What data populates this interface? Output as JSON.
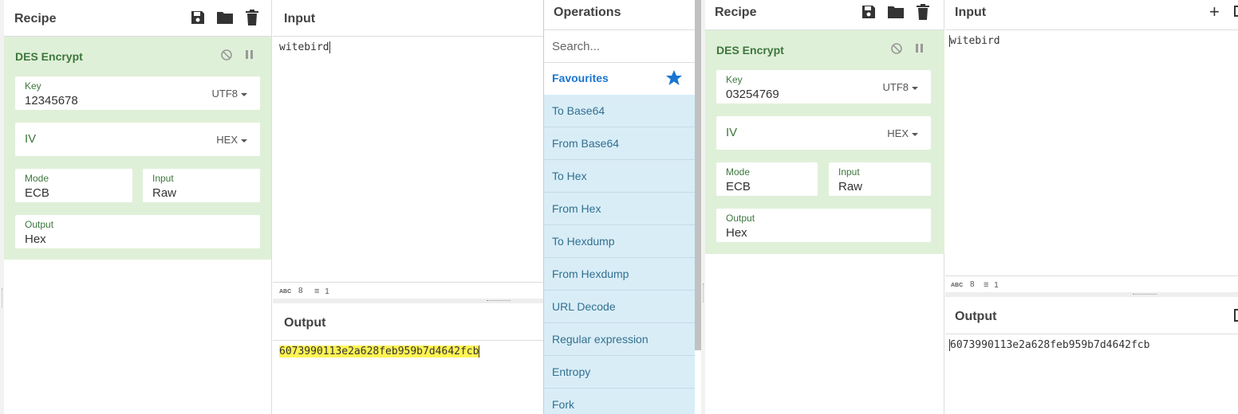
{
  "left": {
    "recipe": {
      "title": "Recipe",
      "operation": {
        "name": "DES Encrypt",
        "key": {
          "label": "Key",
          "value": "12345678",
          "encoding": "UTF8"
        },
        "iv": {
          "label": "IV",
          "encoding": "HEX"
        },
        "mode": {
          "label": "Mode",
          "value": "ECB"
        },
        "input": {
          "label": "Input",
          "value": "Raw"
        },
        "output": {
          "label": "Output",
          "value": "Hex"
        }
      }
    },
    "input": {
      "title": "Input",
      "text": "witebird",
      "stats": {
        "length": "8",
        "lines": "1"
      }
    },
    "output": {
      "title": "Output",
      "text": "6073990113e2a628feb959b7d4642fcb"
    }
  },
  "operations": {
    "title": "Operations",
    "search_placeholder": "Search...",
    "favourites_label": "Favourites",
    "items": [
      "To Base64",
      "From Base64",
      "To Hex",
      "From Hex",
      "To Hexdump",
      "From Hexdump",
      "URL Decode",
      "Regular expression",
      "Entropy",
      "Fork"
    ]
  },
  "right": {
    "recipe": {
      "title": "Recipe",
      "operation": {
        "name": "DES Encrypt",
        "key": {
          "label": "Key",
          "value": "03254769",
          "encoding": "UTF8"
        },
        "iv": {
          "label": "IV",
          "encoding": "HEX"
        },
        "mode": {
          "label": "Mode",
          "value": "ECB"
        },
        "input": {
          "label": "Input",
          "value": "Raw"
        },
        "output": {
          "label": "Output",
          "value": "Hex"
        }
      }
    },
    "input": {
      "title": "Input",
      "text": "witebird",
      "stats": {
        "length": "8",
        "lines": "1"
      }
    },
    "output": {
      "title": "Output",
      "text": "6073990113e2a628feb959b7d4642fcb"
    }
  },
  "colors": {
    "accent_green": "#3c763d",
    "favourites_blue": "#1976d2",
    "ops_bg": "#d9edf7",
    "highlight": "#fff353"
  }
}
